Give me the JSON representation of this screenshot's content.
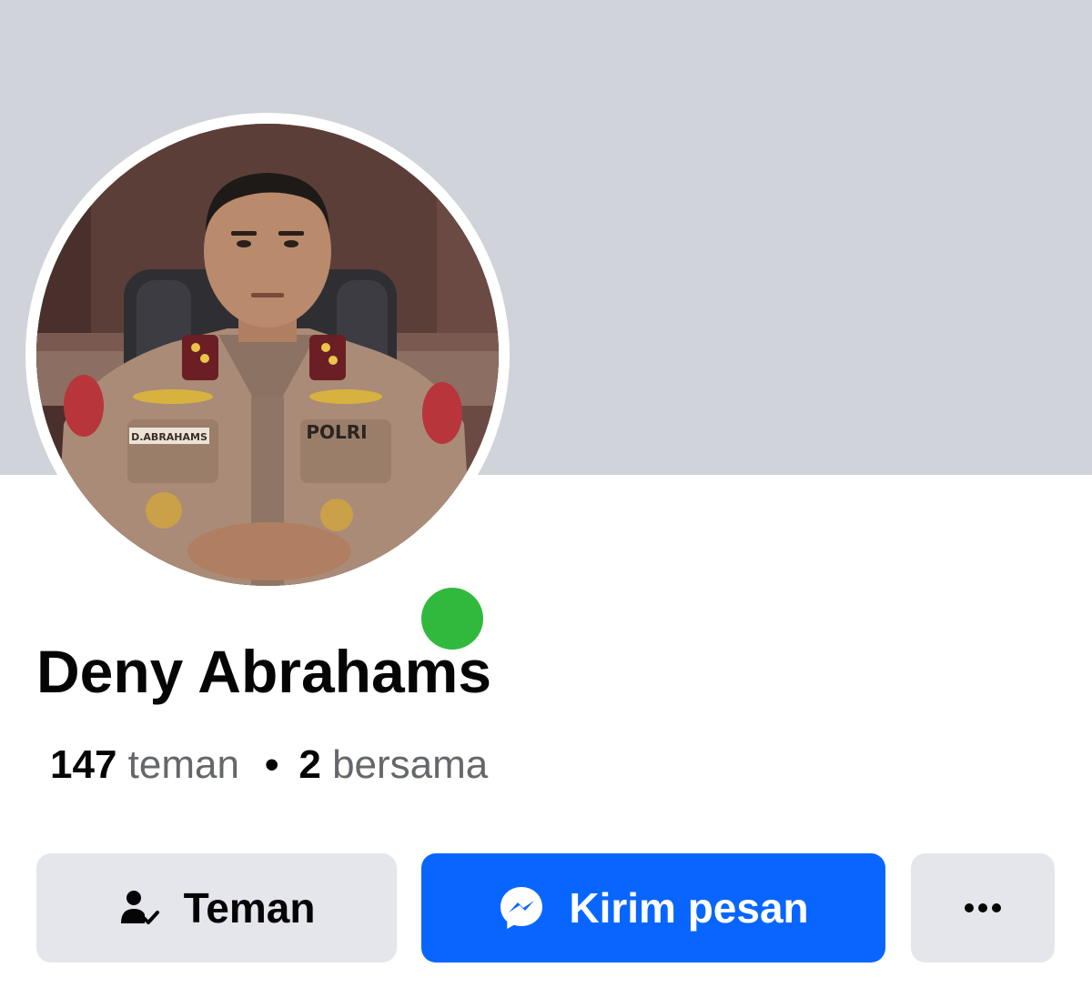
{
  "profile": {
    "name": "Deny Abrahams",
    "friends_count": "147",
    "friends_label": "teman",
    "separator": "•",
    "mutual_count": "2",
    "mutual_label": "bersama",
    "online": true,
    "avatar_badge_text": "POLRI",
    "avatar_nametag_text": "D.ABRAHAMS"
  },
  "actions": {
    "friend_label": "Teman",
    "friend_icon": "person-check-icon",
    "message_label": "Kirim pesan",
    "message_icon": "messenger-icon",
    "more_icon": "more-dots-icon"
  },
  "colors": {
    "cover": "#d0d3d9",
    "accent": "#0866ff",
    "online": "#31b93e",
    "secondary_button": "#e4e6eb"
  }
}
